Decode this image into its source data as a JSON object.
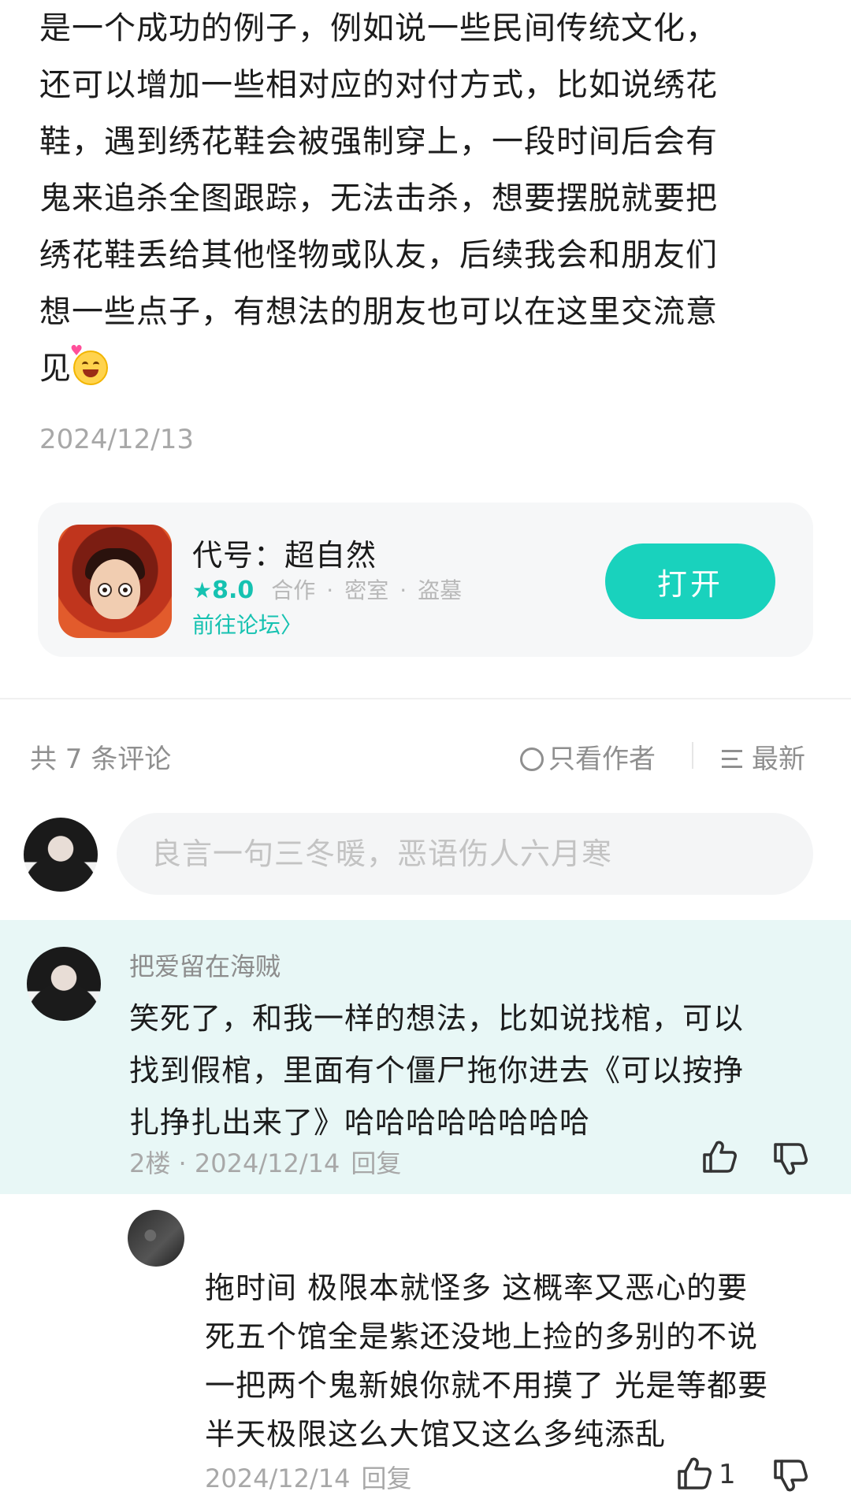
{
  "post": {
    "lines": [
      "是一个成功的例子，例如说一些民间传统文化，",
      "还可以增加一些相对应的对付方式，比如说绣花",
      "鞋，遇到绣花鞋会被强制穿上，一段时间后会有",
      "鬼来追杀全图跟踪，无法击杀，想要摆脱就要把",
      "绣花鞋丢给其他怪物或队友，后续我会和朋友们",
      "想一些点子，有想法的朋友也可以在这里交流意",
      "见"
    ],
    "emoji": "smiling-face-with-hearts-emoji",
    "date": "2024/12/13"
  },
  "game_card": {
    "title": "代号：超自然",
    "star": "★",
    "rating": "8.0",
    "tags": [
      "合作",
      "密室",
      "盗墓"
    ],
    "tag_sep": "·",
    "forum_link": "前往论坛",
    "forum_arrow": "〉",
    "open_button": "打开",
    "accent": "#19d2bd"
  },
  "comments_bar": {
    "count_label": "共 7 条评论",
    "author_only": "只看作者",
    "sort": "最新"
  },
  "comment_input": {
    "placeholder": "良言一句三冬暖，恶语伤人六月寒"
  },
  "comments": [
    {
      "username": "把爱留在海贼",
      "lines": [
        "笑死了，和我一样的想法，比如说找棺，可以",
        "找到假棺，里面有个僵尸拖你进去《可以按挣",
        "扎挣扎出来了》哈哈哈哈哈哈哈哈"
      ],
      "meta": "2楼 · 2024/12/14",
      "reply": "回复",
      "highlight_bg": "#e8f7f6"
    }
  ],
  "replies": [
    {
      "lines": [
        "拖时间 极限本就怪多 这概率又恶心的要",
        "死五个馆全是紫还没地上捡的多别的不说",
        "一把两个鬼新娘你就不用摸了 光是等都要",
        "半天极限这么大馆又这么多纯添乱"
      ],
      "date": "2024/12/14",
      "reply": "回复",
      "likes": "1"
    }
  ]
}
